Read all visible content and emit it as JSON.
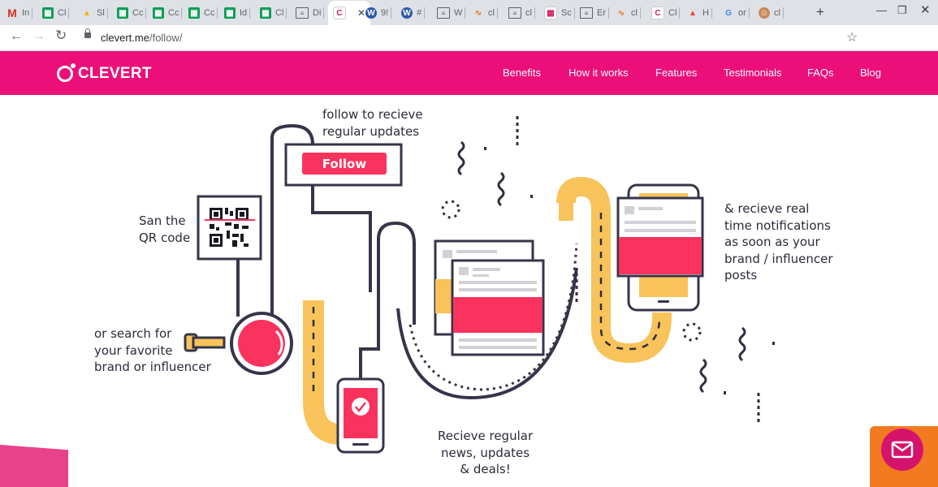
{
  "browser": {
    "tabs": [
      {
        "title": "In",
        "icon": "gmail-icon"
      },
      {
        "title": "Cl",
        "icon": "sheets-icon"
      },
      {
        "title": "Sl",
        "icon": "drive-icon"
      },
      {
        "title": "Cc",
        "icon": "sheets-icon"
      },
      {
        "title": "Cc",
        "icon": "sheets-icon"
      },
      {
        "title": "Cc",
        "icon": "sheets-icon"
      },
      {
        "title": "Id",
        "icon": "sheets-icon"
      },
      {
        "title": "Cl",
        "icon": "sheets-icon"
      },
      {
        "title": "Di",
        "icon": "doc-lines-icon"
      },
      {
        "title": "",
        "icon": "clevert-icon"
      },
      {
        "title": "9!",
        "icon": "w-badge-icon"
      },
      {
        "title": "#",
        "icon": "w-badge-icon"
      },
      {
        "title": "W",
        "icon": "document-icon"
      },
      {
        "title": "cl",
        "icon": "pulse-icon"
      },
      {
        "title": "cl",
        "icon": "document-icon"
      },
      {
        "title": "Sc",
        "icon": "calendar-icon"
      },
      {
        "title": "Er",
        "icon": "document-icon"
      },
      {
        "title": "cl",
        "icon": "pulse-icon"
      },
      {
        "title": "Cl",
        "icon": "clevert-icon"
      },
      {
        "title": "H",
        "icon": "fire-icon"
      },
      {
        "title": "or",
        "icon": "google-icon"
      },
      {
        "title": "cl",
        "icon": "face-icon"
      }
    ],
    "active_tab_index": 9,
    "url_host": "clevert.me",
    "url_path": "/follow/"
  },
  "site": {
    "brand": "CLEVERT",
    "nav": [
      "Benefits",
      "How it works",
      "Features",
      "Testimonials",
      "FAQs",
      "Blog"
    ],
    "accent_color": "#ec0f79"
  },
  "illustration": {
    "captions": {
      "follow": "follow to recieve\nregular updates",
      "scan": "San the\nQR code",
      "search": "or search for\nyour favorite\nbrand or influencer",
      "news": "Recieve regular\nnews, updates\n& deals!",
      "realtime": "& recieve real\ntime notifications\nas soon as your\nbrand / influencer\nposts"
    },
    "follow_button": "Follow"
  }
}
